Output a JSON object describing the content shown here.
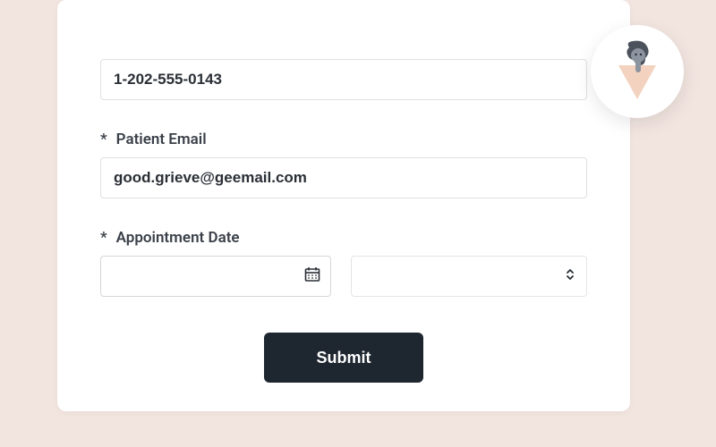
{
  "form": {
    "phone_value": "1-202-555-0143",
    "email_label": "Patient Email",
    "email_value": "good.grieve@geemail.com",
    "date_label": "Appointment Date",
    "date_placeholder": "",
    "submit_label": "Submit",
    "required_mark": "*"
  },
  "icons": {
    "calendar": "calendar-icon",
    "caret": "chevron-up-down-icon",
    "avatar": "avatar-illustration"
  }
}
